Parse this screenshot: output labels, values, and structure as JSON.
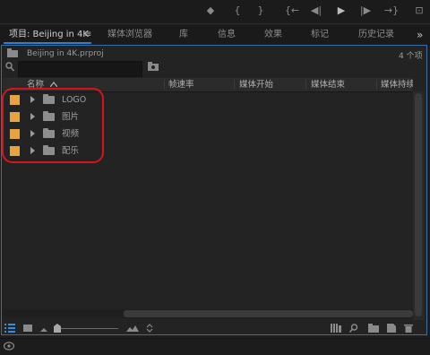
{
  "window": {
    "project_tab_label": "项目: Beijing in 4K",
    "tab_menu_glyph": "≡",
    "tabs": [
      "媒体浏览器",
      "库",
      "信息",
      "效果",
      "标记",
      "历史记录"
    ],
    "overflow_glyph": "»"
  },
  "transport": {
    "icons": [
      "marker-icon",
      "in-point-icon",
      "out-point-icon",
      "go-to-in-icon",
      "step-back-icon",
      "play-icon",
      "step-forward-icon",
      "go-to-out-icon",
      "export-frame-icon"
    ],
    "glyphs": [
      "◆",
      "{",
      "}",
      "{←",
      "◀|",
      "▶",
      "|▶",
      "→}",
      "⊡"
    ]
  },
  "project": {
    "file_name": "Beijing in 4K.prproj",
    "item_count": "4 个项",
    "search_placeholder": ""
  },
  "columns": [
    "名称",
    "帧速率",
    "媒体开始",
    "媒体结束",
    "媒体持续时间"
  ],
  "items": [
    {
      "name": "LOGO",
      "color": "#e8a33d"
    },
    {
      "name": "图片",
      "color": "#e8a33d"
    },
    {
      "name": "视频",
      "color": "#e8a33d"
    },
    {
      "name": "配乐",
      "color": "#e8a33d"
    }
  ],
  "colors": {
    "panel_border": "#3a6fa3",
    "highlight": "#d7141e",
    "label_orange": "#e8a33d",
    "accent": "#2f7fd1"
  }
}
